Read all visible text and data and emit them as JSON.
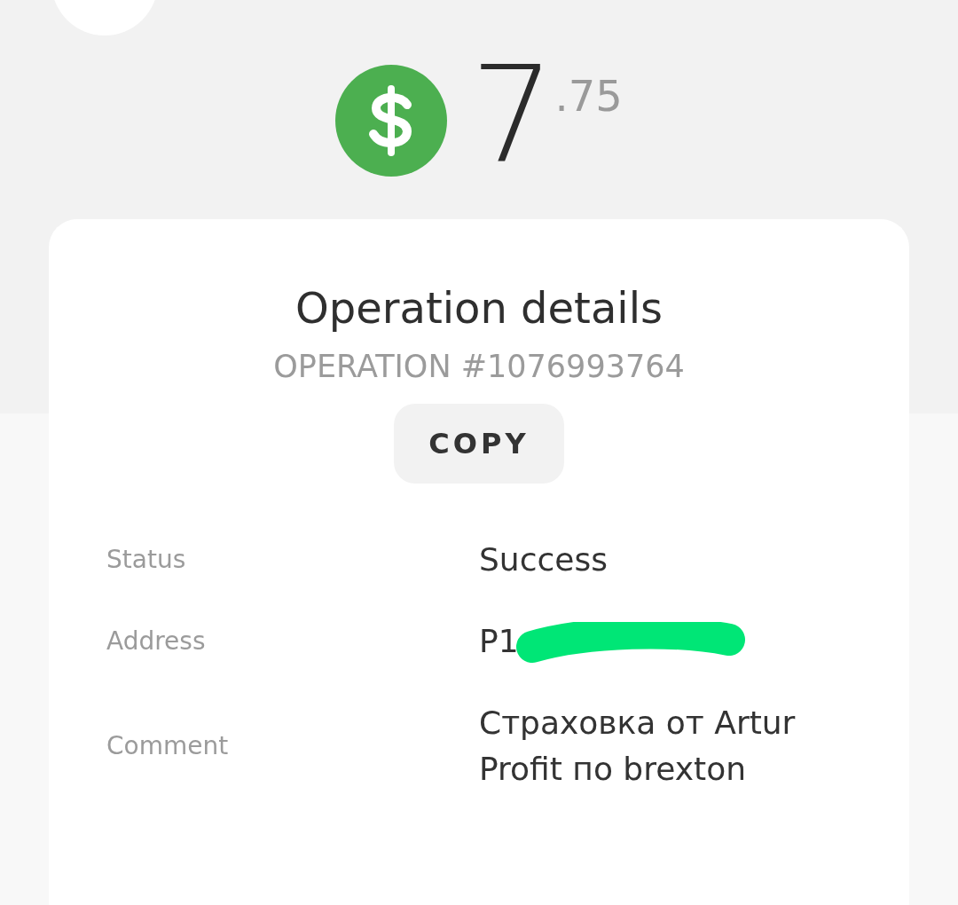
{
  "balance": {
    "whole": "7",
    "fraction": ".75"
  },
  "details": {
    "title": "Operation details",
    "operation": "OPERATION #1076993764",
    "copy_button": "COPY",
    "rows": [
      {
        "label": "Status",
        "value": "Success",
        "redacted": false
      },
      {
        "label": "Address",
        "value": "P1",
        "redacted": true
      },
      {
        "label": "Comment",
        "value": "Страховка от Artur Profit по brexton",
        "redacted": false
      }
    ]
  }
}
